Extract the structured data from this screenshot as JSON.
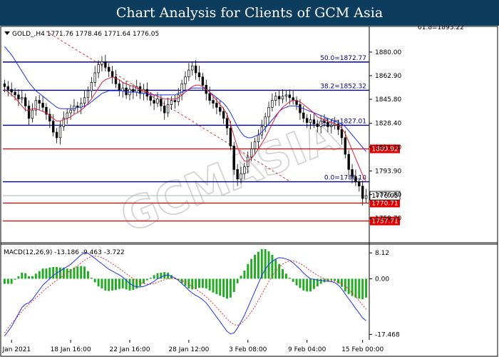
{
  "banner": {
    "title": "Chart Analysis for Clients of GCM Asia"
  },
  "header_text": "GOLD_,H4  1771.76 1778.46 1771.64 1776.05",
  "watermark": "GCMASIA",
  "top_partial_label": "61.8=1893.22",
  "chart_data": [
    {
      "type": "candlestick",
      "symbol": "GOLD_",
      "timeframe": "H4",
      "ohlc_header": {
        "open": 1771.76,
        "high": 1778.46,
        "low": 1771.64,
        "close": 1776.05
      },
      "ylim": [
        1743,
        1897
      ],
      "y_ticks": [
        "1880.00",
        "1862.90",
        "1845.80",
        "1828.40",
        "1811.30",
        "1793.90",
        "1776.80",
        "1759.70"
      ],
      "x_ticks": [
        "12 Jan 2021",
        "18 Jan 16:00",
        "22 Jan 16:00",
        "28 Jan 12:00",
        "3 Feb 08:00",
        "9 Feb 04:00",
        "15 Feb 00:00"
      ],
      "fibonacci": [
        {
          "label": "50.0=1872.77",
          "value": 1872.77
        },
        {
          "label": "38.2=1852.32",
          "value": 1852.32
        },
        {
          "label": "23.6=1827.01",
          "value": 1827.01
        },
        {
          "label": "0.0=1786.10",
          "value": 1786.1
        }
      ],
      "horizontal_levels": [
        {
          "label": "1809.92",
          "value": 1809.92,
          "color": "#e00000"
        },
        {
          "label": "1770.71",
          "value": 1770.71,
          "color": "#e00000"
        },
        {
          "label": "1757.71",
          "value": 1757.71,
          "color": "#e00000"
        }
      ],
      "current_price": {
        "label": "1776.05",
        "value": 1776.05
      },
      "ma_fast_color": "#e0203c",
      "ma_slow_color": "#2233ee",
      "closes": [
        1855,
        1853,
        1851,
        1849,
        1846,
        1847,
        1841,
        1832,
        1838,
        1845,
        1843,
        1840,
        1835,
        1830,
        1822,
        1818,
        1826,
        1832,
        1836,
        1838,
        1841,
        1840,
        1843,
        1847,
        1852,
        1858,
        1865,
        1871,
        1873,
        1869,
        1866,
        1862,
        1857,
        1852,
        1854,
        1849,
        1853,
        1851,
        1855,
        1850,
        1853,
        1848,
        1845,
        1843,
        1846,
        1841,
        1836,
        1842,
        1845,
        1844,
        1849,
        1857,
        1862,
        1867,
        1870,
        1865,
        1862,
        1856,
        1850,
        1845,
        1843,
        1840,
        1837,
        1832,
        1825,
        1812,
        1795,
        1788,
        1792,
        1797,
        1804,
        1810,
        1815,
        1820,
        1826,
        1833,
        1840,
        1845,
        1848,
        1846,
        1848,
        1849,
        1847,
        1845,
        1842,
        1836,
        1832,
        1829,
        1831,
        1828,
        1826,
        1830,
        1829,
        1826,
        1827,
        1828,
        1824,
        1818,
        1806,
        1795,
        1790,
        1786,
        1783,
        1774,
        1776
      ],
      "ma_fast": [
        1853,
        1851,
        1849,
        1847,
        1844,
        1841,
        1838,
        1838,
        1839,
        1839,
        1838,
        1837,
        1836,
        1834,
        1832,
        1830,
        1830,
        1831,
        1832,
        1833,
        1835,
        1836,
        1838,
        1840,
        1843,
        1846,
        1850,
        1854,
        1858,
        1860,
        1861,
        1862,
        1861,
        1860,
        1858,
        1857,
        1856,
        1855,
        1854,
        1853,
        1852,
        1851,
        1850,
        1849,
        1848,
        1847,
        1846,
        1846,
        1846,
        1846,
        1847,
        1849,
        1851,
        1853,
        1855,
        1856,
        1856,
        1855,
        1853,
        1851,
        1848,
        1845,
        1842,
        1839,
        1835,
        1828,
        1819,
        1811,
        1805,
        1801,
        1801,
        1803,
        1806,
        1810,
        1814,
        1818,
        1823,
        1828,
        1833,
        1837,
        1840,
        1842,
        1844,
        1845,
        1845,
        1844,
        1842,
        1840,
        1838,
        1836,
        1833,
        1832,
        1831,
        1830,
        1829,
        1828,
        1827,
        1825,
        1821,
        1815,
        1809,
        1803,
        1797,
        1791,
        1786
      ],
      "ma_slow": [
        1884,
        1881,
        1878,
        1874,
        1870,
        1866,
        1862,
        1858,
        1855,
        1852,
        1850,
        1848,
        1846,
        1844,
        1842,
        1840,
        1839,
        1839,
        1839,
        1839,
        1839,
        1840,
        1840,
        1841,
        1842,
        1844,
        1846,
        1848,
        1850,
        1851,
        1852,
        1852,
        1852,
        1852,
        1852,
        1851,
        1851,
        1851,
        1851,
        1850,
        1850,
        1850,
        1849,
        1849,
        1849,
        1849,
        1849,
        1849,
        1849,
        1849,
        1850,
        1851,
        1852,
        1853,
        1854,
        1854,
        1854,
        1854,
        1853,
        1851,
        1849,
        1847,
        1845,
        1843,
        1840,
        1836,
        1831,
        1826,
        1822,
        1819,
        1818,
        1818,
        1819,
        1820,
        1822,
        1825,
        1828,
        1831,
        1834,
        1837,
        1839,
        1840,
        1841,
        1841,
        1841,
        1840,
        1839,
        1838,
        1837,
        1836,
        1835,
        1834,
        1833,
        1832,
        1831,
        1830,
        1829,
        1828,
        1826,
        1823,
        1820,
        1817,
        1814,
        1811,
        1808
      ],
      "macd": {
        "label": "MACD(12,26,9) -13.186 -9.463 -3.722",
        "params": [
          12,
          26,
          9
        ],
        "macd_value": -13.186,
        "signal_value": -9.463,
        "histogram_value": -3.722,
        "y_ticks": [
          "8.12",
          "0.00",
          "-17.468"
        ],
        "ylim": [
          -18.5,
          9.5
        ],
        "histogram_color": "#22aa22",
        "signal_color": "#e03030",
        "macd_line_color": "#2233ee",
        "macd_line": [
          -18,
          -16.5,
          -15,
          -13,
          -11,
          -9,
          -8,
          -7.5,
          -6.5,
          -5,
          -3.5,
          -2,
          -1,
          0,
          1,
          1.8,
          2.5,
          3.2,
          3.8,
          4.5,
          5.5,
          6.5,
          7.5,
          8.2,
          8,
          7.2,
          6.4,
          5.5,
          4.7,
          3.8,
          3,
          2.4,
          1.8,
          1.2,
          0.5,
          -0.5,
          -1.5,
          -2.2,
          -2.5,
          -2.6,
          -2.4,
          -2,
          -1.5,
          -0.8,
          0,
          0.5,
          1,
          1.2,
          0.8,
          0.2,
          -0.5,
          -1.5,
          -2.5,
          -3.6,
          -4.5,
          -5.2,
          -5.8,
          -6.6,
          -7.6,
          -9,
          -10.5,
          -12,
          -13.5,
          -15,
          -16.5,
          -17.3,
          -17,
          -15.5,
          -13.5,
          -11.5,
          -9,
          -6.5,
          -4,
          -1.5,
          1,
          3,
          4.5,
          5.5,
          6.2,
          6.6,
          6.5,
          6.2,
          5.8,
          5,
          4,
          3,
          1.8,
          0.8,
          0,
          -0.2,
          -0.4,
          -0.5,
          -0.7,
          -0.8,
          -0.9,
          -1.2,
          -2,
          -3.2,
          -4.8,
          -6.3,
          -7.8,
          -9.3,
          -10.8,
          -12.3,
          -13.2
        ],
        "signal_line": [
          -17,
          -15.5,
          -14,
          -12.8,
          -11.5,
          -10.2,
          -9.1,
          -8,
          -7,
          -6,
          -5,
          -4,
          -3,
          -2.2,
          -1.3,
          -0.5,
          0.3,
          1,
          1.8,
          2.6,
          3.3,
          4.1,
          5,
          5.8,
          6.5,
          7,
          7.1,
          7,
          6.6,
          6.1,
          5.4,
          4.7,
          4,
          3.2,
          2.4,
          1.6,
          0.8,
          0,
          -0.6,
          -1.1,
          -1.5,
          -1.7,
          -1.7,
          -1.5,
          -1.1,
          -0.7,
          -0.3,
          0,
          0.1,
          0,
          -0.2,
          -0.6,
          -1.1,
          -1.7,
          -2.4,
          -3.2,
          -4,
          -4.8,
          -5.7,
          -6.7,
          -7.8,
          -9,
          -10.2,
          -11.4,
          -12.6,
          -13.6,
          -14.4,
          -14.6,
          -14.1,
          -13.1,
          -11.9,
          -10.4,
          -8.7,
          -6.8,
          -4.8,
          -2.8,
          -0.9,
          0.8,
          2.4,
          3.7,
          4.6,
          5.2,
          5.6,
          5.6,
          5.3,
          4.8,
          4.1,
          3.3,
          2.5,
          1.8,
          1.1,
          0.5,
          0,
          -0.3,
          -0.6,
          -0.8,
          -1.1,
          -1.6,
          -2.3,
          -3.3,
          -4.4,
          -5.6,
          -6.9,
          -8.3,
          -9.5
        ]
      }
    }
  ]
}
